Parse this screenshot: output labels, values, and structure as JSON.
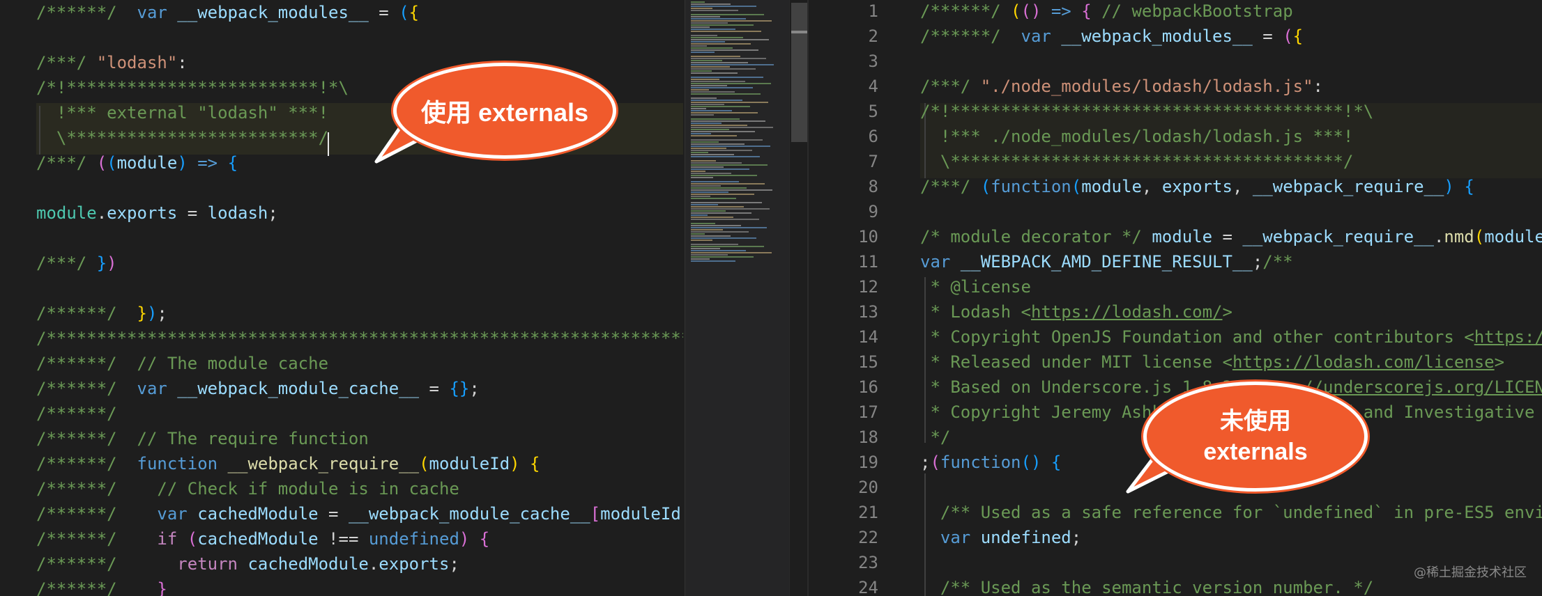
{
  "left_editor": {
    "lines": [
      [
        [
          "c-comment",
          "/******/  "
        ],
        [
          "c-kw",
          "var "
        ],
        [
          "c-var",
          "__webpack_modules__"
        ],
        [
          "c-plain",
          " = "
        ],
        [
          "c-br3",
          "("
        ],
        [
          "c-br1",
          "{"
        ]
      ],
      [],
      [
        [
          "c-comment",
          "/***/ "
        ],
        [
          "c-str",
          "\"lodash\""
        ],
        [
          "c-plain",
          ":"
        ]
      ],
      [
        [
          "c-comment",
          "/*!*************************!*\\"
        ]
      ],
      [
        [
          "c-comment",
          "  !*** external \"lodash\" ***!"
        ]
      ],
      [
        [
          "c-comment",
          "  \\*************************/"
        ]
      ],
      [
        [
          "c-comment",
          "/***/ "
        ],
        [
          "c-br2",
          "("
        ],
        [
          "c-br3",
          "("
        ],
        [
          "c-var",
          "module"
        ],
        [
          "c-br3",
          ")"
        ],
        [
          "c-kw",
          " => "
        ],
        [
          "c-br3",
          "{"
        ]
      ],
      [],
      [
        [
          "c-type",
          "module"
        ],
        [
          "c-plain",
          "."
        ],
        [
          "c-var",
          "exports"
        ],
        [
          "c-plain",
          " = "
        ],
        [
          "c-var",
          "lodash"
        ],
        [
          "c-plain",
          ";"
        ]
      ],
      [],
      [
        [
          "c-comment",
          "/***/ "
        ],
        [
          "c-br3",
          "}"
        ],
        [
          "c-br2",
          ")"
        ]
      ],
      [],
      [
        [
          "c-comment",
          "/******/  "
        ],
        [
          "c-br1",
          "}"
        ],
        [
          "c-br3",
          ")"
        ],
        [
          "c-plain",
          ";"
        ]
      ],
      [
        [
          "c-comment",
          "/************************************************************************/"
        ]
      ],
      [
        [
          "c-comment",
          "/******/  // The module cache"
        ]
      ],
      [
        [
          "c-comment",
          "/******/  "
        ],
        [
          "c-kw",
          "var "
        ],
        [
          "c-var",
          "__webpack_module_cache__"
        ],
        [
          "c-plain",
          " = "
        ],
        [
          "c-br3",
          "{}"
        ],
        [
          "c-plain",
          ";"
        ]
      ],
      [
        [
          "c-comment",
          "/******/"
        ]
      ],
      [
        [
          "c-comment",
          "/******/  // The require function"
        ]
      ],
      [
        [
          "c-comment",
          "/******/  "
        ],
        [
          "c-kw",
          "function "
        ],
        [
          "c-fn",
          "__webpack_require__"
        ],
        [
          "c-br1",
          "("
        ],
        [
          "c-var",
          "moduleId"
        ],
        [
          "c-br1",
          ")"
        ],
        [
          "c-plain",
          " "
        ],
        [
          "c-br1",
          "{"
        ]
      ],
      [
        [
          "c-comment",
          "/******/    // Check if module is in cache"
        ]
      ],
      [
        [
          "c-comment",
          "/******/    "
        ],
        [
          "c-kw",
          "var "
        ],
        [
          "c-var",
          "cachedModule"
        ],
        [
          "c-plain",
          " = "
        ],
        [
          "c-var",
          "__webpack_module_cache__"
        ],
        [
          "c-br2",
          "["
        ],
        [
          "c-var",
          "moduleId"
        ],
        [
          "c-br2",
          "]"
        ]
      ],
      [
        [
          "c-comment",
          "/******/    "
        ],
        [
          "c-ctrl",
          "if "
        ],
        [
          "c-br2",
          "("
        ],
        [
          "c-var",
          "cachedModule"
        ],
        [
          "c-plain",
          " !== "
        ],
        [
          "c-kw",
          "undefined"
        ],
        [
          "c-br2",
          ")"
        ],
        [
          "c-plain",
          " "
        ],
        [
          "c-br2",
          "{"
        ]
      ],
      [
        [
          "c-comment",
          "/******/      "
        ],
        [
          "c-ctrl",
          "return "
        ],
        [
          "c-var",
          "cachedModule"
        ],
        [
          "c-plain",
          "."
        ],
        [
          "c-var",
          "exports"
        ],
        [
          "c-plain",
          ";"
        ]
      ],
      [
        [
          "c-comment",
          "/******/    "
        ],
        [
          "c-br2",
          "}"
        ]
      ]
    ]
  },
  "right_editor": {
    "line_numbers": [
      "1",
      "2",
      "3",
      "4",
      "5",
      "6",
      "7",
      "8",
      "9",
      "10",
      "11",
      "12",
      "13",
      "14",
      "15",
      "16",
      "17",
      "18",
      "19",
      "20",
      "21",
      "22",
      "23",
      "24"
    ],
    "lines": [
      [
        [
          "c-comment",
          "/******/ "
        ],
        [
          "c-br1",
          "("
        ],
        [
          "c-br2",
          "()"
        ],
        [
          "c-kw",
          " => "
        ],
        [
          "c-br2",
          "{"
        ],
        [
          "c-comment",
          " // webpackBootstrap"
        ]
      ],
      [
        [
          "c-comment",
          "/******/  "
        ],
        [
          "c-kw",
          "var "
        ],
        [
          "c-var",
          "__webpack_modules__"
        ],
        [
          "c-plain",
          " = "
        ],
        [
          "c-br2",
          "("
        ],
        [
          "c-br1",
          "{"
        ]
      ],
      [],
      [
        [
          "c-comment",
          "/***/ "
        ],
        [
          "c-str",
          "\"./node_modules/lodash/lodash.js\""
        ],
        [
          "c-plain",
          ":"
        ]
      ],
      [
        [
          "c-comment",
          "/*!***************************************!*\\"
        ]
      ],
      [
        [
          "c-comment",
          "  !*** ./node_modules/lodash/lodash.js ***!"
        ]
      ],
      [
        [
          "c-comment",
          "  \\***************************************/"
        ]
      ],
      [
        [
          "c-comment",
          "/***/ "
        ],
        [
          "c-br3",
          "("
        ],
        [
          "c-kw",
          "function"
        ],
        [
          "c-br3",
          "("
        ],
        [
          "c-var",
          "module"
        ],
        [
          "c-plain",
          ", "
        ],
        [
          "c-var",
          "exports"
        ],
        [
          "c-plain",
          ", "
        ],
        [
          "c-var",
          "__webpack_require__"
        ],
        [
          "c-br3",
          ")"
        ],
        [
          "c-plain",
          " "
        ],
        [
          "c-br3",
          "{"
        ]
      ],
      [],
      [
        [
          "c-comment",
          "/* module decorator */ "
        ],
        [
          "c-var",
          "module"
        ],
        [
          "c-plain",
          " = "
        ],
        [
          "c-var",
          "__webpack_require__"
        ],
        [
          "c-plain",
          "."
        ],
        [
          "c-fn",
          "nmd"
        ],
        [
          "c-br1",
          "("
        ],
        [
          "c-var",
          "module"
        ]
      ],
      [
        [
          "c-kw",
          "var "
        ],
        [
          "c-var",
          "__WEBPACK_AMD_DEFINE_RESULT__"
        ],
        [
          "c-plain",
          ";"
        ],
        [
          "c-comment",
          "/**"
        ]
      ],
      [
        [
          "c-comment",
          " * @license"
        ]
      ],
      [
        [
          "c-comment",
          " * Lodash <"
        ],
        [
          "c-comment c-link",
          "https://lodash.com/"
        ],
        [
          "c-comment",
          ">"
        ]
      ],
      [
        [
          "c-comment",
          " * Copyright OpenJS Foundation and other contributors <"
        ],
        [
          "c-comment c-link",
          "https:/"
        ]
      ],
      [
        [
          "c-comment",
          " * Released under MIT license <"
        ],
        [
          "c-comment c-link",
          "https://lodash.com/license"
        ],
        [
          "c-comment",
          ">"
        ]
      ],
      [
        [
          "c-comment",
          " * Based on Underscore.js 1.8.3 <"
        ],
        [
          "c-comment c-link",
          "http://underscorejs.org/LICEN"
        ]
      ],
      [
        [
          "c-comment",
          " * Copyright Jeremy Ashkenas, DocumentCloud and Investigative"
        ]
      ],
      [
        [
          "c-comment",
          " */"
        ]
      ],
      [
        [
          "c-plain",
          ";"
        ],
        [
          "c-br2",
          "("
        ],
        [
          "c-kw",
          "function"
        ],
        [
          "c-br3",
          "()"
        ],
        [
          "c-plain",
          " "
        ],
        [
          "c-br3",
          "{"
        ]
      ],
      [],
      [
        [
          "c-comment",
          "  /** Used as a safe reference for `undefined` in pre-ES5 envi"
        ]
      ],
      [
        [
          "c-plain",
          "  "
        ],
        [
          "c-kw",
          "var "
        ],
        [
          "c-var",
          "undefined"
        ],
        [
          "c-plain",
          ";"
        ]
      ],
      [],
      [
        [
          "c-comment",
          "  /** Used as the semantic version number. */"
        ]
      ]
    ]
  },
  "callouts": {
    "left": "使用 externals",
    "right_line1": "未使用",
    "right_line2": "externals"
  },
  "watermark": "@稀土掘金技术社区"
}
